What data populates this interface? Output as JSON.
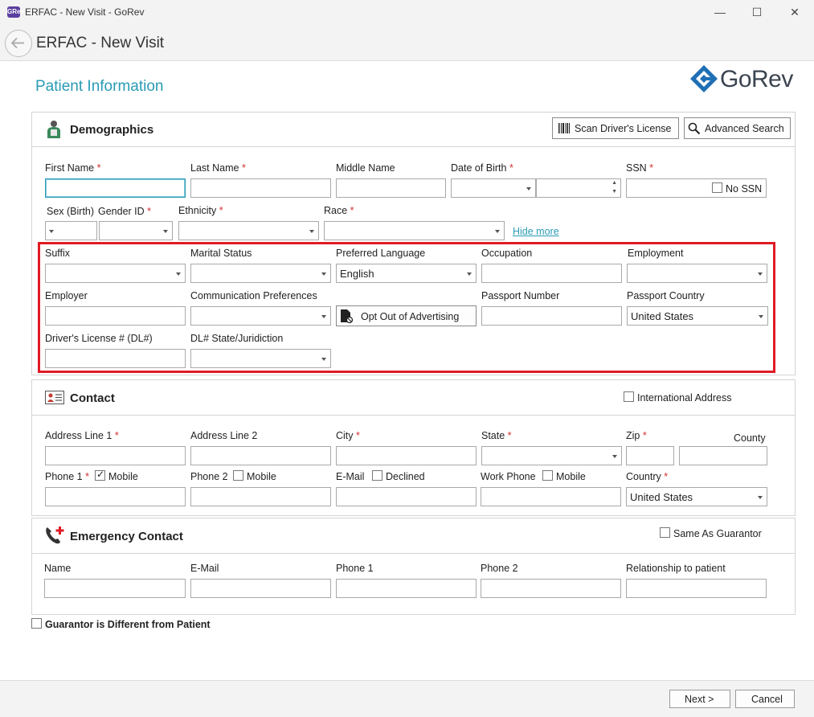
{
  "window": {
    "title": "ERFAC - New Visit - GoRev",
    "app_icon_text": "GRev",
    "minimize": "—",
    "maximize": "☐",
    "close": "✕"
  },
  "header": {
    "title": "ERFAC - New Visit"
  },
  "page": {
    "title": "Patient Information",
    "logo_text": "GoRev"
  },
  "colors": {
    "accent": "#2a9bb5",
    "required": "#d32f2f",
    "highlight": "#e01b24",
    "logo": "#1f6fb5"
  },
  "demographics": {
    "title": "Demographics",
    "scan_button": "Scan Driver's License",
    "search_button": "Advanced Search",
    "labels": {
      "first_name": "First Name",
      "last_name": "Last Name",
      "middle_name": "Middle Name",
      "dob": "Date of Birth",
      "ssn": "SSN",
      "no_ssn": "No SSN",
      "sex_birth": "Sex (Birth)",
      "gender_id": "Gender ID",
      "ethnicity": "Ethnicity",
      "race": "Race",
      "hide_more": "Hide more",
      "suffix": "Suffix",
      "marital_status": "Marital Status",
      "preferred_language": "Preferred Language",
      "occupation": "Occupation",
      "employment": "Employment",
      "employer": "Employer",
      "communication_preferences": "Communication Preferences",
      "passport_number": "Passport Number",
      "passport_country": "Passport Country",
      "drivers_license": "Driver's License # (DL#)",
      "dl_state": "DL# State/Juridiction"
    },
    "values": {
      "preferred_language": "English",
      "passport_country": "United States"
    },
    "opt_out_button": "Opt Out of Advertising"
  },
  "contact": {
    "title": "Contact",
    "international_address": "International Address",
    "labels": {
      "address1": "Address Line 1",
      "address2": "Address Line 2",
      "city": "City",
      "state": "State",
      "zip": "Zip",
      "county": "County",
      "phone1": "Phone 1",
      "mobile": "Mobile",
      "phone2": "Phone 2",
      "email": "E-Mail",
      "declined": "Declined",
      "work_phone": "Work Phone",
      "country": "Country"
    },
    "values": {
      "country": "United States"
    }
  },
  "emergency": {
    "title": "Emergency Contact",
    "same_as_guarantor": "Same As Guarantor",
    "labels": {
      "name": "Name",
      "email": "E-Mail",
      "phone1": "Phone 1",
      "phone2": "Phone 2",
      "relationship": "Relationship to patient"
    }
  },
  "guarantor_different": "Guarantor is Different from Patient",
  "required_marker": "*",
  "footer": {
    "next": "Next >",
    "cancel": "Cancel"
  }
}
